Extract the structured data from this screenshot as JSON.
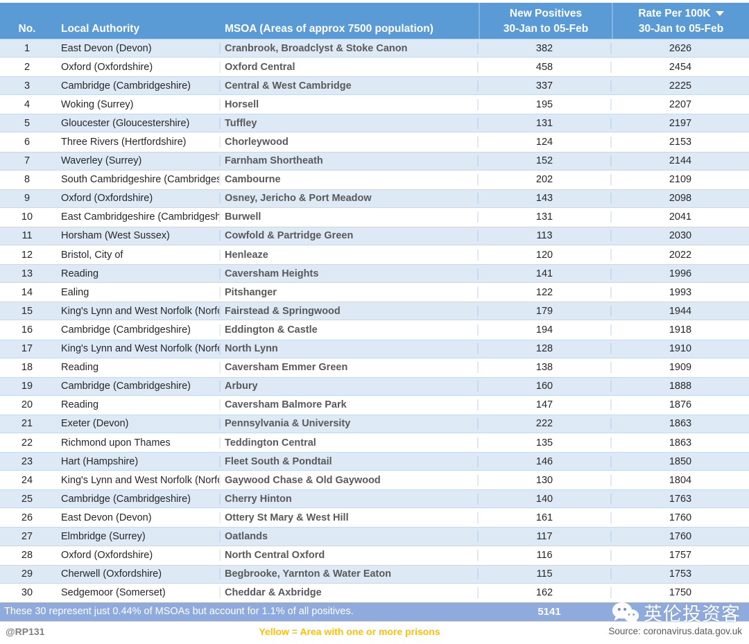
{
  "header": {
    "columns": [
      {
        "key": "no",
        "line1": "No.",
        "line2": ""
      },
      {
        "key": "la",
        "line1": "Local Authority",
        "line2": ""
      },
      {
        "key": "msoa",
        "line1": "MSOA (Areas of approx 7500 population)",
        "line2": ""
      },
      {
        "key": "new",
        "line1": "New Positives",
        "line2": "30-Jan to 05-Feb"
      },
      {
        "key": "rate",
        "line1": "Rate Per 100K",
        "line2": "30-Jan to 05-Feb",
        "sort_icon": "caret-down-icon"
      }
    ]
  },
  "rows": [
    {
      "no": "1",
      "la": "East Devon (Devon)",
      "msoa": "Cranbrook, Broadclyst & Stoke Canon",
      "new": "382",
      "rate": "2626"
    },
    {
      "no": "2",
      "la": "Oxford (Oxfordshire)",
      "msoa": "Oxford Central",
      "new": "458",
      "rate": "2454"
    },
    {
      "no": "3",
      "la": "Cambridge (Cambridgeshire)",
      "msoa": "Central & West Cambridge",
      "new": "337",
      "rate": "2225"
    },
    {
      "no": "4",
      "la": "Woking (Surrey)",
      "msoa": "Horsell",
      "new": "195",
      "rate": "2207"
    },
    {
      "no": "5",
      "la": "Gloucester (Gloucestershire)",
      "msoa": "Tuffley",
      "new": "131",
      "rate": "2197"
    },
    {
      "no": "6",
      "la": "Three Rivers (Hertfordshire)",
      "msoa": "Chorleywood",
      "new": "124",
      "rate": "2153"
    },
    {
      "no": "7",
      "la": "Waverley (Surrey)",
      "msoa": "Farnham Shortheath",
      "new": "152",
      "rate": "2144"
    },
    {
      "no": "8",
      "la": "South Cambridgeshire (Cambridgeshire)",
      "msoa": "Cambourne",
      "new": "202",
      "rate": "2109"
    },
    {
      "no": "9",
      "la": "Oxford (Oxfordshire)",
      "msoa": "Osney, Jericho & Port Meadow",
      "new": "143",
      "rate": "2098"
    },
    {
      "no": "10",
      "la": "East Cambridgeshire (Cambridgeshire)",
      "msoa": "Burwell",
      "new": "131",
      "rate": "2041"
    },
    {
      "no": "11",
      "la": "Horsham (West Sussex)",
      "msoa": "Cowfold & Partridge Green",
      "new": "113",
      "rate": "2030"
    },
    {
      "no": "12",
      "la": "Bristol, City of",
      "msoa": "Henleaze",
      "new": "120",
      "rate": "2022"
    },
    {
      "no": "13",
      "la": "Reading",
      "msoa": "Caversham Heights",
      "new": "141",
      "rate": "1996"
    },
    {
      "no": "14",
      "la": "Ealing",
      "msoa": "Pitshanger",
      "new": "122",
      "rate": "1993"
    },
    {
      "no": "15",
      "la": "King's Lynn and West Norfolk (Norfolk)",
      "msoa": "Fairstead & Springwood",
      "new": "179",
      "rate": "1944"
    },
    {
      "no": "16",
      "la": "Cambridge (Cambridgeshire)",
      "msoa": "Eddington & Castle",
      "new": "194",
      "rate": "1918"
    },
    {
      "no": "17",
      "la": "King's Lynn and West Norfolk (Norfolk)",
      "msoa": "North Lynn",
      "new": "128",
      "rate": "1910"
    },
    {
      "no": "18",
      "la": "Reading",
      "msoa": "Caversham Emmer Green",
      "new": "138",
      "rate": "1909"
    },
    {
      "no": "19",
      "la": "Cambridge (Cambridgeshire)",
      "msoa": "Arbury",
      "new": "160",
      "rate": "1888"
    },
    {
      "no": "20",
      "la": "Reading",
      "msoa": "Caversham Balmore Park",
      "new": "147",
      "rate": "1876"
    },
    {
      "no": "21",
      "la": "Exeter (Devon)",
      "msoa": "Pennsylvania & University",
      "new": "222",
      "rate": "1863"
    },
    {
      "no": "22",
      "la": "Richmond upon Thames",
      "msoa": "Teddington Central",
      "new": "135",
      "rate": "1863"
    },
    {
      "no": "23",
      "la": "Hart (Hampshire)",
      "msoa": "Fleet South & Pondtail",
      "new": "146",
      "rate": "1850"
    },
    {
      "no": "24",
      "la": "King's Lynn and West Norfolk (Norfolk)",
      "msoa": "Gaywood Chase & Old Gaywood",
      "new": "130",
      "rate": "1804"
    },
    {
      "no": "25",
      "la": "Cambridge (Cambridgeshire)",
      "msoa": "Cherry Hinton",
      "new": "140",
      "rate": "1763"
    },
    {
      "no": "26",
      "la": "East Devon (Devon)",
      "msoa": "Ottery St Mary & West Hill",
      "new": "161",
      "rate": "1760"
    },
    {
      "no": "27",
      "la": "Elmbridge (Surrey)",
      "msoa": "Oatlands",
      "new": "117",
      "rate": "1760"
    },
    {
      "no": "28",
      "la": "Oxford (Oxfordshire)",
      "msoa": "North Central Oxford",
      "new": "116",
      "rate": "1757"
    },
    {
      "no": "29",
      "la": "Cherwell (Oxfordshire)",
      "msoa": "Begbrooke, Yarnton & Water Eaton",
      "new": "115",
      "rate": "1753"
    },
    {
      "no": "30",
      "la": "Sedgemoor (Somerset)",
      "msoa": "Cheddar & Axbridge",
      "new": "162",
      "rate": "1750"
    }
  ],
  "summary": {
    "text": "These 30 represent just 0.44% of MSOAs but account for 1.1% of all positives.",
    "total_new_positives": "5141"
  },
  "footer": {
    "handle": "@RP131",
    "legend": "Yellow = Area with one or more prisons",
    "source": "Source: coronavirus.data.gov.uk"
  },
  "watermark": {
    "text": "英伦投资客",
    "logo_icon": "wechat-logo-icon"
  },
  "colors": {
    "header_blue": "#5B9BD5",
    "row_alt_blue": "#DDEAF6",
    "summary_blue": "#8FAADC",
    "legend_yellow": "#FFC000",
    "msoa_text": "#595959"
  }
}
